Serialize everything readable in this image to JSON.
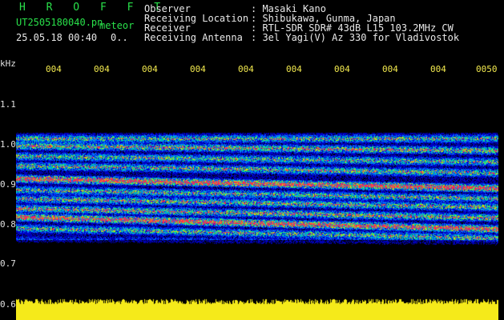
{
  "brand": "H R O F F T",
  "filename": "UT2505180040.pn",
  "meteor_label": "meteor",
  "datetime": "25.05.18 00:40",
  "count_label": "0..",
  "info": {
    "labels": [
      "Observer",
      "Receiving Location",
      "Receiver",
      "Receiving Antenna"
    ],
    "values": [
      ": Masaki Kano",
      ": Shibukawa, Gunma, Japan",
      ": RTL-SDR SDR# 43dB L15 103.2MHz CW",
      ": 3el Yagi(V) Az 330 for Vladivostok"
    ]
  },
  "axis": {
    "unit": "kHz",
    "y_ticks": [
      "1.1",
      "1.0",
      "0.9",
      "0.8",
      "0.7",
      "0.6"
    ],
    "x_ticks": [
      "004",
      "004",
      "004",
      "004",
      "004",
      "004",
      "004",
      "004",
      "004",
      "0050"
    ]
  },
  "colors": {
    "background": "#000000",
    "tick_text": "#f2e94e",
    "meter": "#f5ea1a",
    "brand": "#29e04a"
  }
}
